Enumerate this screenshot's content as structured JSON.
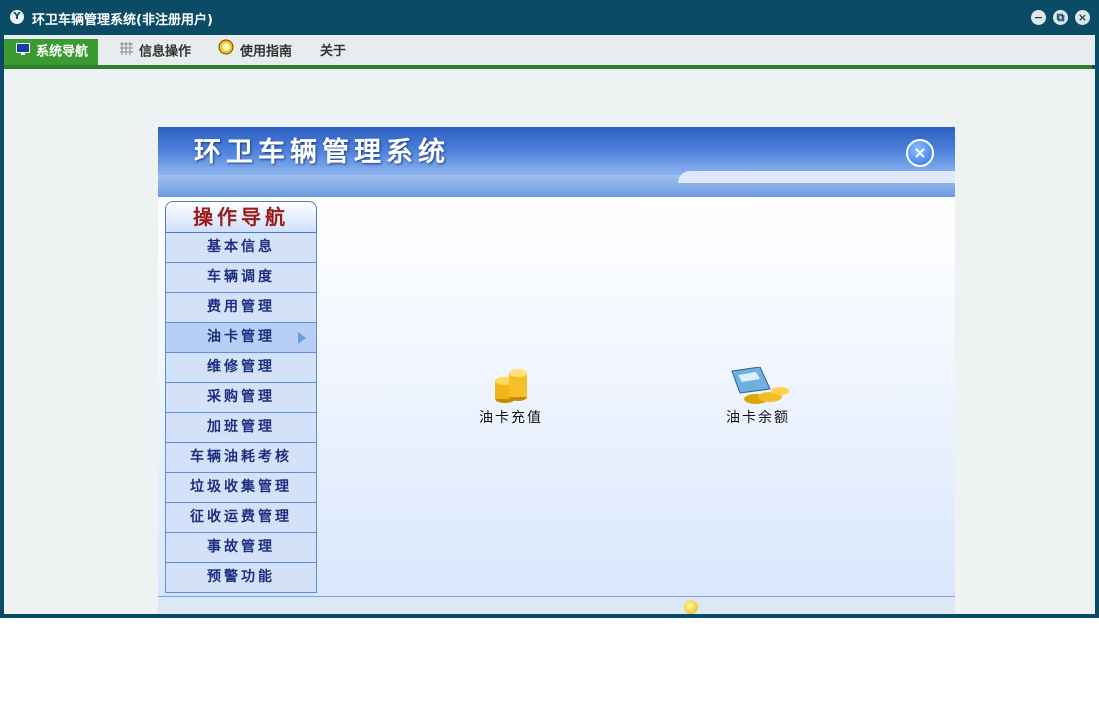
{
  "window": {
    "title": "环卫车辆管理系统(非注册用户)",
    "logo_icon": "app-logo-icon",
    "controls": [
      "minimize",
      "restore",
      "close"
    ]
  },
  "menubar": {
    "items": [
      {
        "label": "系统导航",
        "icon": "monitor-icon",
        "active": true
      },
      {
        "label": "信息操作",
        "icon": "grid-icon",
        "active": false
      },
      {
        "label": "使用指南",
        "icon": "clock-icon",
        "active": false
      },
      {
        "label": "关于",
        "icon": "",
        "active": false
      }
    ]
  },
  "app": {
    "title": "环卫车辆管理系统",
    "sidebar": {
      "title": "操作导航",
      "items": [
        {
          "label": "基本信息"
        },
        {
          "label": "车辆调度"
        },
        {
          "label": "费用管理"
        },
        {
          "label": "油卡管理",
          "selected": true
        },
        {
          "label": "维修管理"
        },
        {
          "label": "采购管理"
        },
        {
          "label": "加班管理"
        },
        {
          "label": "车辆油耗考核"
        },
        {
          "label": "垃圾收集管理"
        },
        {
          "label": "征收运费管理"
        },
        {
          "label": "事故管理"
        },
        {
          "label": "预警功能"
        }
      ]
    },
    "features": [
      {
        "label": "油卡充值",
        "icon": "coins-icon"
      },
      {
        "label": "油卡余额",
        "icon": "calculator-coins-icon"
      }
    ]
  },
  "colors": {
    "titlebar": "#0a4b66",
    "menu_active": "#3c9a32",
    "menu_line": "#2e7d2a",
    "nav_text": "#1d2f7d",
    "nav_title": "#9c1a1a"
  }
}
